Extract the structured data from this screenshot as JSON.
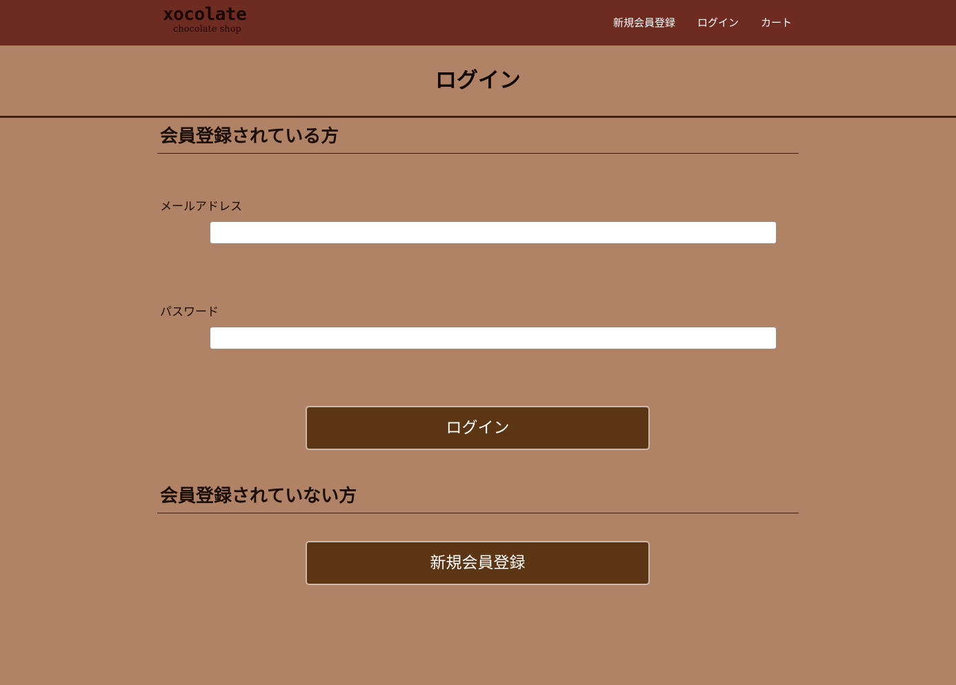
{
  "header": {
    "logo_main": "xocolate",
    "logo_sub": "chocolate shop",
    "nav": [
      {
        "label": "新規会員登録"
      },
      {
        "label": "ログイン"
      },
      {
        "label": "カート"
      }
    ]
  },
  "page": {
    "title": "ログイン"
  },
  "member_section": {
    "heading": "会員登録されている方",
    "email_label": "メールアドレス",
    "email_value": "",
    "password_label": "パスワード",
    "password_value": "",
    "login_button": "ログイン"
  },
  "guest_section": {
    "heading": "会員登録されていない方",
    "register_button": "新規会員登録"
  },
  "colors": {
    "header_bg": "#6e2b22",
    "page_bg": "#b08266",
    "button_bg": "#5c3514"
  }
}
